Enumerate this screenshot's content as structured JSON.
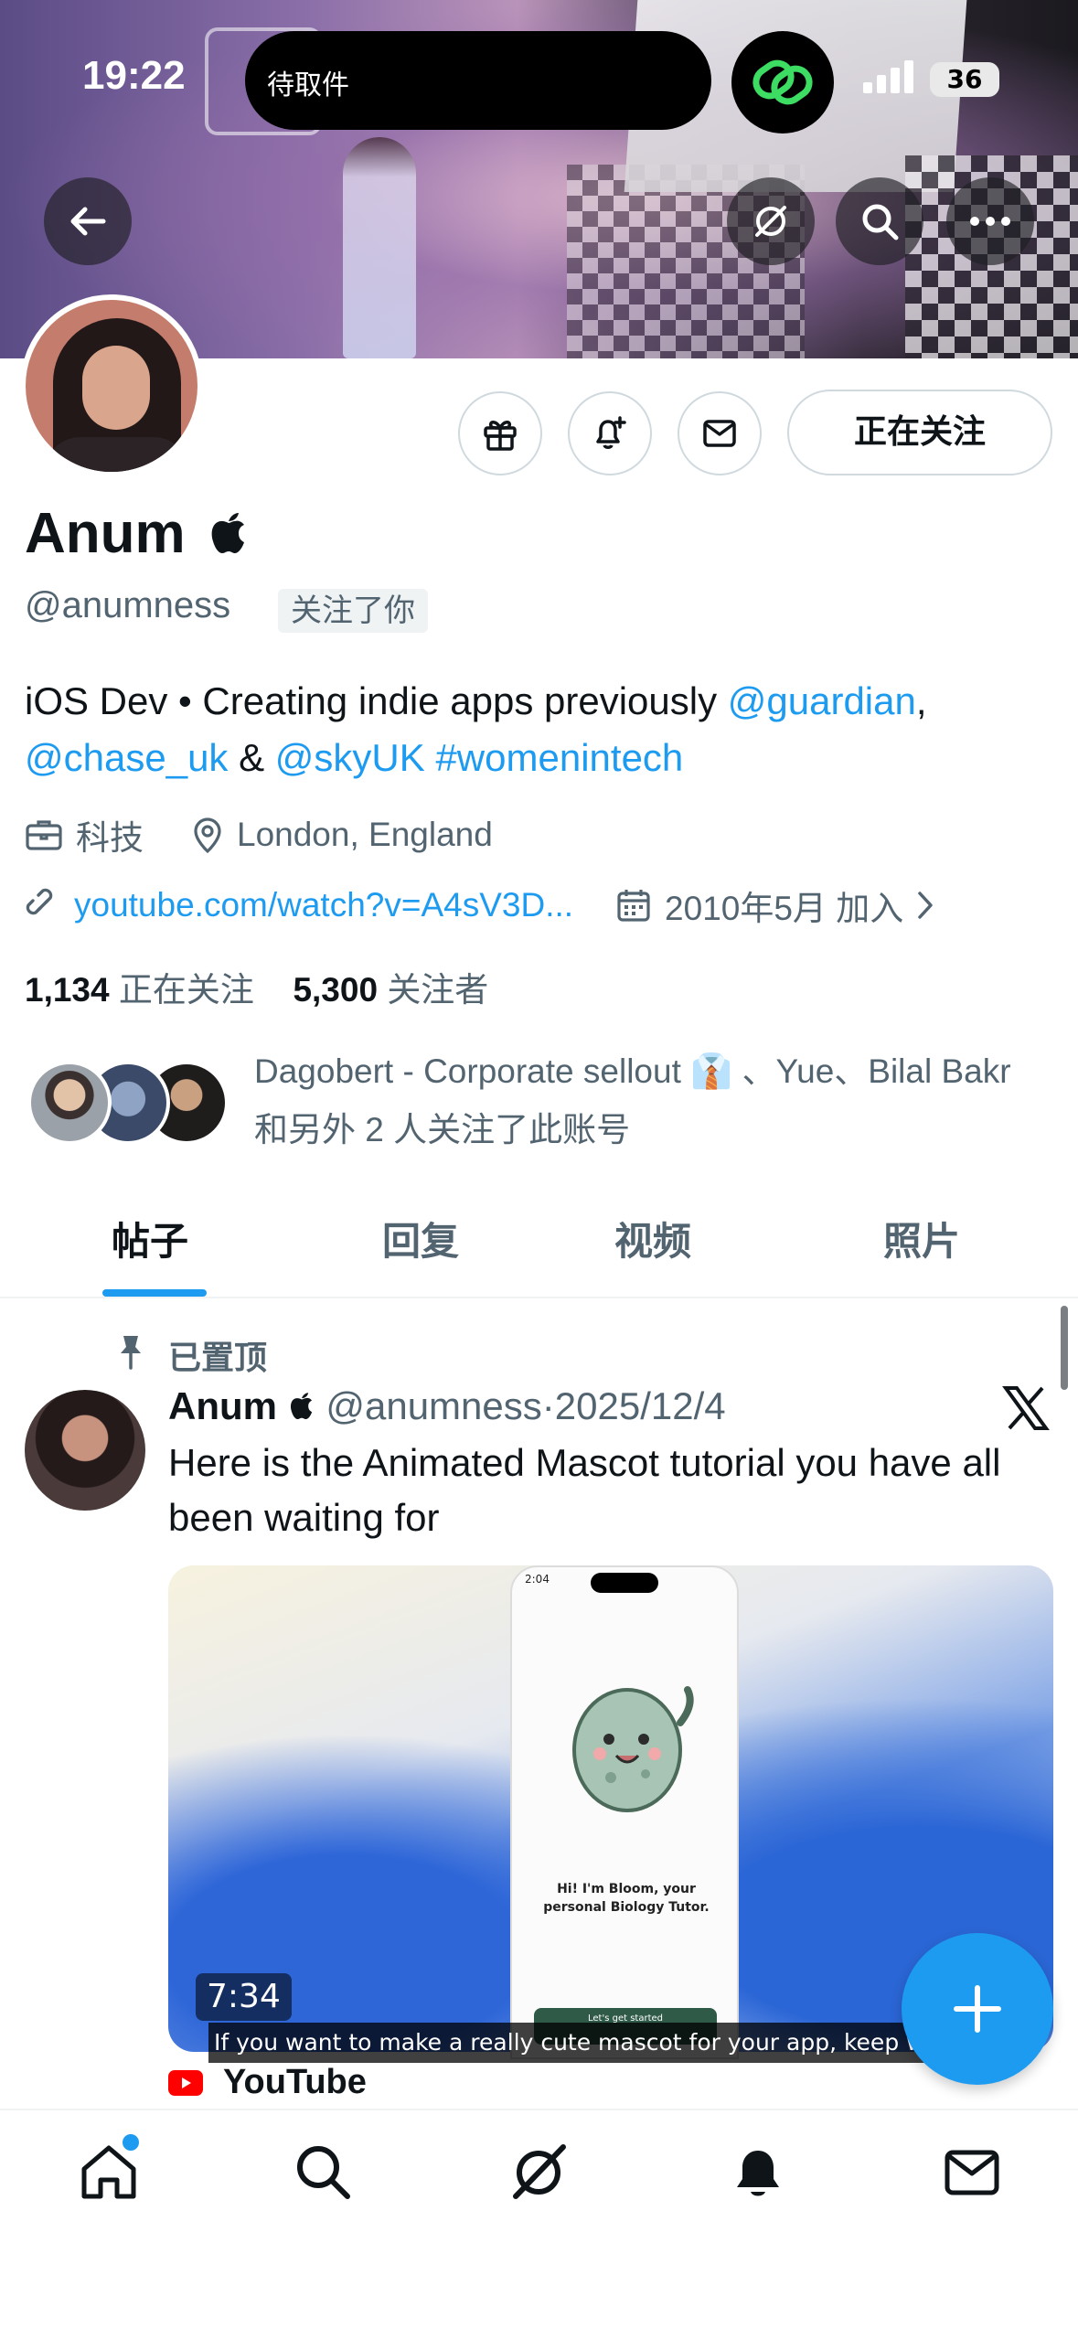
{
  "status_bar": {
    "time": "19:22",
    "live_activity": "待取件",
    "battery": "36"
  },
  "profile": {
    "name": "Anum",
    "name_badge_icon": "apple-logo-icon",
    "handle": "@anumness",
    "follows_you": "关注了你",
    "follow_button": "正在关注",
    "bio": {
      "text_1": "iOS Dev • Creating indie apps previously ",
      "mention_guardian": "@guardian",
      "comma": ",",
      "mention_chase": "@chase_uk",
      "amp": " & ",
      "mention_sky": "@skyUK",
      "space": " ",
      "hashtag": "#womenintech"
    },
    "category": "科技",
    "location": "London, England",
    "website": "youtube.com/watch?v=A4sV3D...",
    "joined": "2010年5月 加入",
    "following_count": "1,134",
    "following_label": "正在关注",
    "followers_count": "5,300",
    "followers_label": "关注者",
    "followed_by_text": "Dagobert - Corporate sellout 👔 、Yue、Bilal Bakr 和另外 2 人关注了此账号"
  },
  "tabs": [
    {
      "label": "帖子",
      "active": true
    },
    {
      "label": "回复",
      "active": false
    },
    {
      "label": "视频",
      "active": false
    },
    {
      "label": "照片",
      "active": false
    }
  ],
  "post": {
    "pinned_label": "已置顶",
    "author": "Anum",
    "handle": "@anumness",
    "separator": "·",
    "date": "2025/12/4",
    "text": "Here is the Animated Mascot tutorial you have all been waiting for",
    "video_duration": "7:34",
    "video_caption": "If you want to make a really cute mascot for your app, keep watching",
    "phone_screen_time": "2:04",
    "phone_screen_title": "Hi! I'm Bloom, your personal Biology Tutor.",
    "phone_screen_button": "Let's get started",
    "source": "YouTube"
  },
  "bottom_nav": [
    {
      "icon": "home-icon",
      "has_dot": true
    },
    {
      "icon": "search-icon"
    },
    {
      "icon": "grok-icon"
    },
    {
      "icon": "bell-icon"
    },
    {
      "icon": "mail-icon"
    }
  ],
  "colors": {
    "accent": "#1d9bf0",
    "secondary_text": "#536471",
    "primary_text": "#0f1419"
  }
}
